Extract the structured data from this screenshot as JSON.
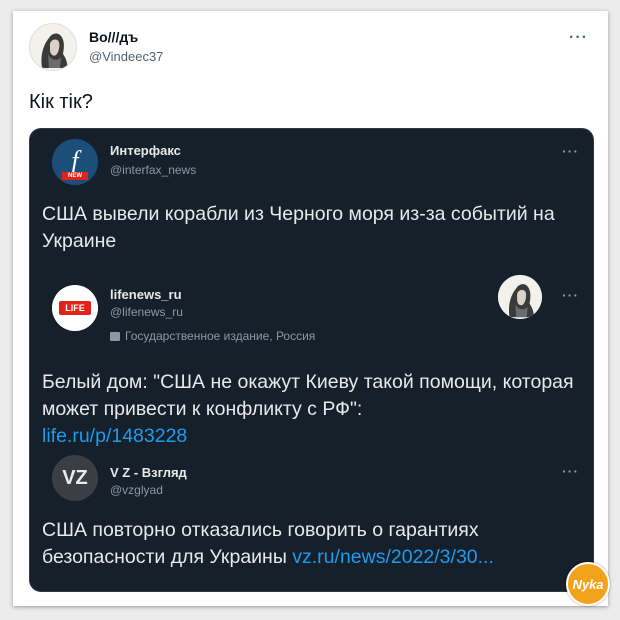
{
  "outer_tweet": {
    "name": "Bo///дъ",
    "handle": "@Vindeec37",
    "text": "Кік тік?",
    "more": "···"
  },
  "quoted_tweets": [
    {
      "name": "Интерфакс",
      "handle": "@interfax_news",
      "text": "США вывели корабли из Черного моря из-за событий на Украине",
      "more": "···",
      "avatar_badge": "NEW"
    },
    {
      "name": "lifenews_ru",
      "handle": "@lifenews_ru",
      "label": "Государственное издание, Россия",
      "text": "Белый дом: \"США не окажут Киеву такой помощи, которая может привести к конфликту с РФ\":",
      "link": "life.ru/p/1483228",
      "more": "···",
      "avatar_text": "LIFE"
    },
    {
      "name": "V Z - Взгляд",
      "handle": "@vzglyad",
      "text": "США повторно отказались говорить о гарантиях безопасности для Украины",
      "link": "vz.ru/news/2022/3/30...",
      "more": "···",
      "avatar_text": "VZ"
    }
  ],
  "watermark": "Nyka",
  "colors": {
    "dark_bg": "#15202b",
    "link": "#1d9bf0",
    "interfax": "#1b3a57",
    "life_red": "#e2231a"
  }
}
